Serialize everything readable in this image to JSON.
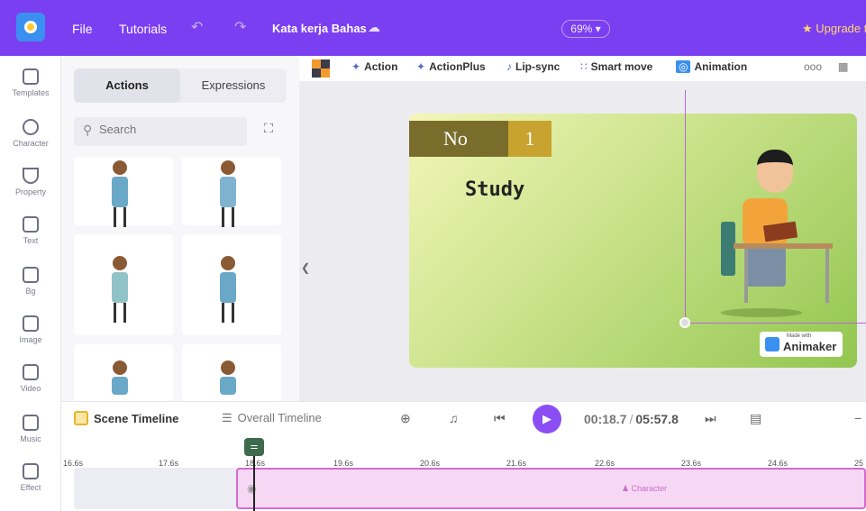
{
  "topbar": {
    "menu": [
      "File",
      "Tutorials"
    ],
    "undo_icon": "↶",
    "redo_icon": "↷",
    "project_title": "Kata kerja Bahas",
    "cloud_icon": "☁",
    "zoom": "69%",
    "upgrade": "★ Upgrade t"
  },
  "rail": [
    {
      "label": "Templates",
      "icon": "templates-icon"
    },
    {
      "label": "Character",
      "icon": "character-icon"
    },
    {
      "label": "Property",
      "icon": "property-icon"
    },
    {
      "label": "Text",
      "icon": "text-icon"
    },
    {
      "label": "Bg",
      "icon": "bg-icon"
    },
    {
      "label": "Image",
      "icon": "image-icon"
    },
    {
      "label": "Video",
      "icon": "video-icon"
    },
    {
      "label": "Music",
      "icon": "music-icon"
    },
    {
      "label": "Effect",
      "icon": "effect-icon"
    }
  ],
  "panel": {
    "tabs": [
      "Actions",
      "Expressions"
    ],
    "search_placeholder": "Search"
  },
  "toolbar": {
    "items": [
      "Action",
      "ActionPlus",
      "Lip-sync",
      "Smart move",
      "Animation"
    ],
    "more": "ooo"
  },
  "scene": {
    "no_label": "No",
    "number": "1",
    "word": "Study",
    "badge_made": "Made with",
    "badge_brand": "Animaker"
  },
  "timeline": {
    "scene_tab": "Scene Timeline",
    "overall_tab": "Overall Timeline",
    "current_time": "00:18.7",
    "separator": "/",
    "total_time": "05:57.8",
    "track_label": "Character",
    "ruler": [
      "16.6s",
      "17.6s",
      "18.6s",
      "19.6s",
      "20.6s",
      "21.6s",
      "22.6s",
      "23.6s",
      "24.6s",
      "25"
    ]
  },
  "colors": {
    "brand": "#7b3ff2",
    "play": "#8b4ef5",
    "track": "#d66ad0"
  }
}
